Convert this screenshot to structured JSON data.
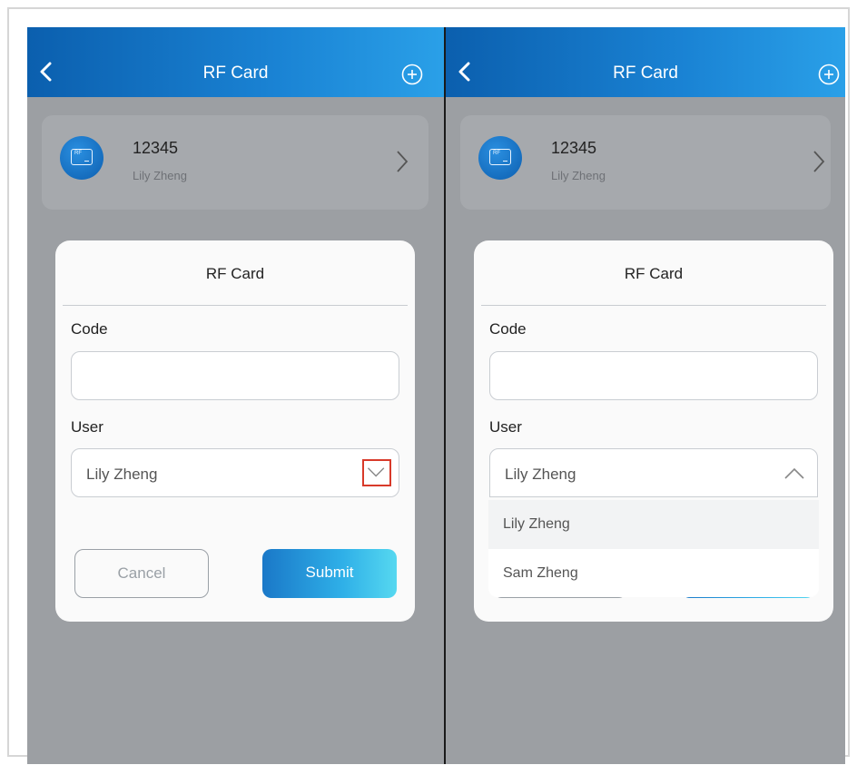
{
  "screens": [
    {
      "header": {
        "title": "RF Card",
        "back_icon": "chevron-left-icon",
        "add_icon": "plus-circle-icon"
      },
      "card": {
        "code": "12345",
        "user": "Lily Zheng",
        "icon_label": "RF"
      },
      "dialog": {
        "title": "RF Card",
        "code_label": "Code",
        "code_value": "",
        "user_label": "User",
        "user_value": "Lily Zheng",
        "cancel_label": "Cancel",
        "submit_label": "Submit",
        "dropdown_state": "collapsed"
      }
    },
    {
      "header": {
        "title": "RF Card",
        "back_icon": "chevron-left-icon",
        "add_icon": "plus-circle-icon"
      },
      "card": {
        "code": "12345",
        "user": "Lily Zheng",
        "icon_label": "RF"
      },
      "dialog": {
        "title": "RF Card",
        "code_label": "Code",
        "code_value": "",
        "user_label": "User",
        "user_value": "Lily Zheng",
        "dropdown_state": "expanded",
        "options": [
          "Lily Zheng",
          "Sam Zheng"
        ],
        "selected_option": "Lily Zheng"
      }
    }
  ],
  "colors": {
    "header_gradient_start": "#0b5fae",
    "header_gradient_end": "#2aa0e8",
    "overlay": "#9c9fa3",
    "submit_gradient_start": "#1a78c8",
    "submit_gradient_end": "#56d8f0",
    "highlight_border": "#d83a2a"
  }
}
